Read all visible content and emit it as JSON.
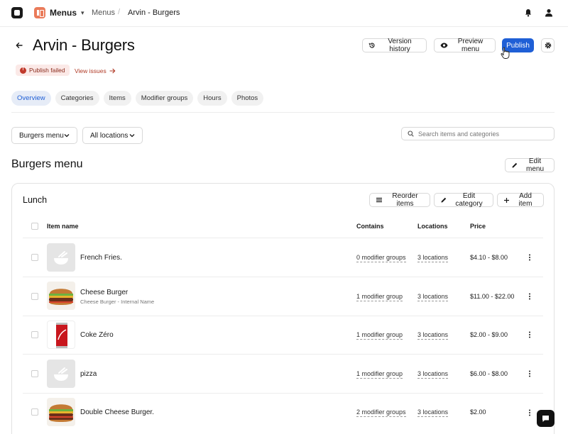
{
  "nav": {
    "app_label": "Menus",
    "breadcrumb": [
      "Menus",
      "Arvin - Burgers"
    ]
  },
  "header": {
    "title": "Arvin - Burgers",
    "buttons": {
      "version_history": "Version history",
      "preview_menu": "Preview menu",
      "publish": "Publish"
    },
    "publish_status": "Publish failed",
    "view_issues": "View issues"
  },
  "tabs": [
    {
      "label": "Overview",
      "active": true
    },
    {
      "label": "Categories",
      "active": false
    },
    {
      "label": "Items",
      "active": false
    },
    {
      "label": "Modifier groups",
      "active": false
    },
    {
      "label": "Hours",
      "active": false
    },
    {
      "label": "Photos",
      "active": false
    }
  ],
  "filters": {
    "menu_select": "Burgers menu",
    "location_select": "All locations",
    "search_placeholder": "Search items and categories"
  },
  "section": {
    "title": "Burgers menu",
    "edit_menu": "Edit menu"
  },
  "category": {
    "title": "Lunch",
    "buttons": {
      "reorder": "Reorder items",
      "edit_category": "Edit category",
      "add_item": "Add item"
    },
    "columns": [
      "Item name",
      "Contains",
      "Locations",
      "Price"
    ],
    "rows": [
      {
        "name": "French Fries.",
        "subtitle": "",
        "contains": "0 modifier groups",
        "locations": "3 locations",
        "price": "$4.10 - $8.00",
        "image": "placeholder-bowl"
      },
      {
        "name": "Cheese Burger",
        "subtitle": "Cheese Burger - Internal Name",
        "contains": "1 modifier group",
        "locations": "3 locations",
        "price": "$11.00 - $22.00",
        "image": "burger"
      },
      {
        "name": "Coke Zéro",
        "subtitle": "",
        "contains": "1 modifier group",
        "locations": "3 locations",
        "price": "$2.00 - $9.00",
        "image": "coke-can"
      },
      {
        "name": "pizza",
        "subtitle": "",
        "contains": "1 modifier group",
        "locations": "3 locations",
        "price": "$6.00 - $8.00",
        "image": "placeholder-bowl"
      },
      {
        "name": "Double Cheese Burger.",
        "subtitle": "",
        "contains": "2 modifier groups",
        "locations": "3 locations",
        "price": "$2.00",
        "image": "burger"
      }
    ]
  },
  "colors": {
    "primary": "#1f5fd6",
    "error": "#c0392b",
    "app_icon": "#ea7b5a"
  }
}
